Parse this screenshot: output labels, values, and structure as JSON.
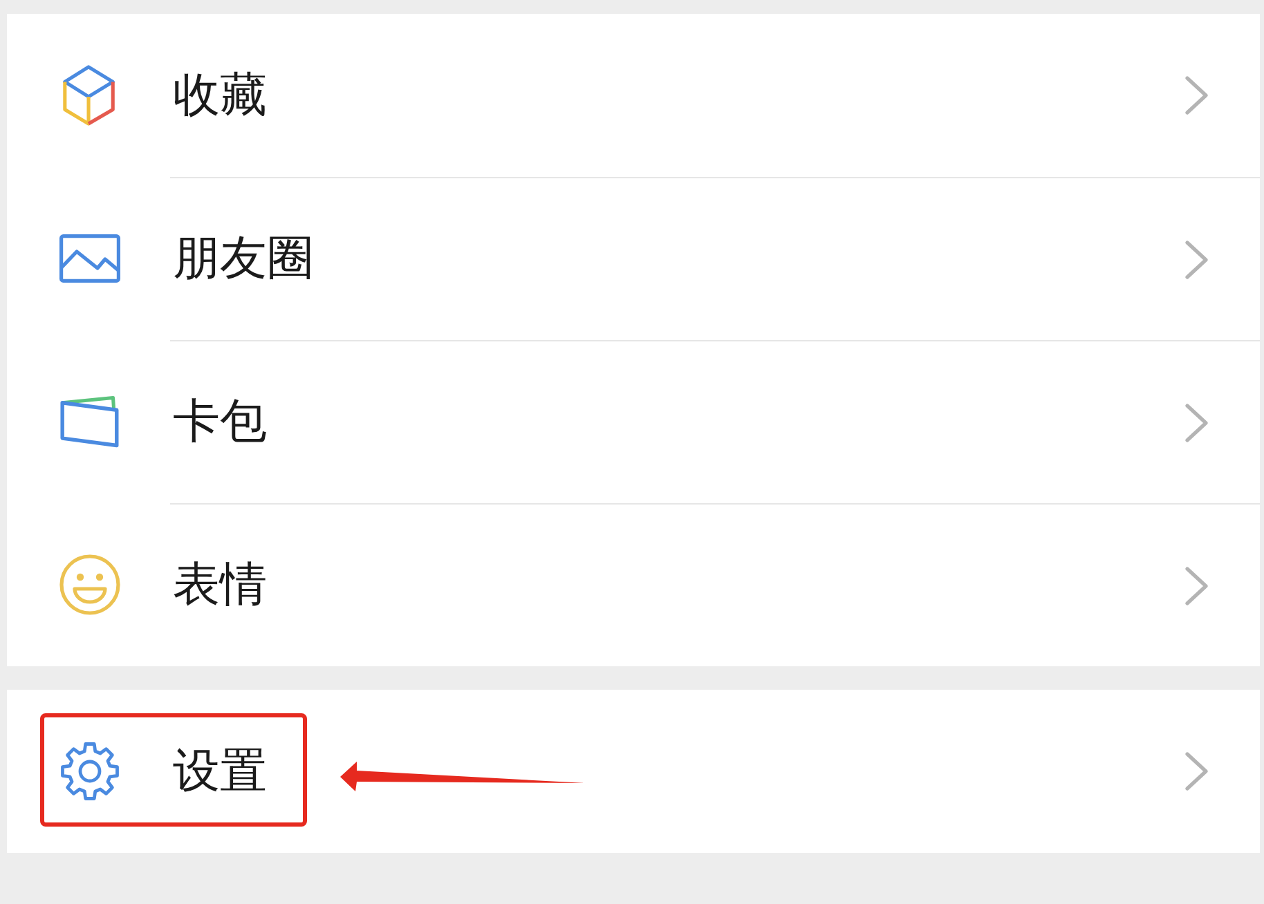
{
  "groups": [
    {
      "items": [
        {
          "kind": "favorites",
          "label": "收藏",
          "highlighted": false
        },
        {
          "kind": "moments",
          "label": "朋友圈",
          "highlighted": false
        },
        {
          "kind": "cards",
          "label": "卡包",
          "highlighted": false
        },
        {
          "kind": "stickers",
          "label": "表情",
          "highlighted": false
        }
      ]
    },
    {
      "items": [
        {
          "kind": "settings",
          "label": "设置",
          "highlighted": true
        }
      ]
    }
  ]
}
